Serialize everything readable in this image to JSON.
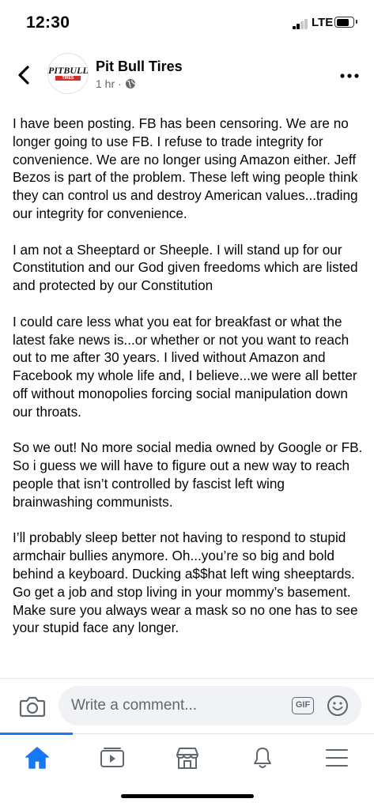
{
  "status_bar": {
    "time": "12:30",
    "network": "LTE",
    "signal_bars_filled": 2,
    "signal_bars_total": 4,
    "battery_level": 0.75
  },
  "header": {
    "page_name": "Pit Bull Tires",
    "time_ago": "1 hr",
    "separator": "·",
    "back_icon": "chevron-left-icon",
    "more_icon": "ellipsis-icon",
    "privacy_icon": "globe-icon",
    "logo_text": "PITBULL",
    "logo_sub": "TIRES"
  },
  "post": {
    "paragraphs": [
      "I have been posting.  FB has been censoring.  We are no longer going to use FB.  I refuse to trade integrity for convenience.  We are no longer using Amazon either. Jeff Bezos is part of the problem.  These left wing people think they can control us and destroy American values...trading our integrity for convenience.",
      "I am not a Sheeptard or Sheeple.  I will stand up for our Constitution and our God given freedoms which are listed and protected by our Constitution",
      "I could care less what you eat for breakfast or what the latest fake news is...or whether or not you want to reach out to me after 30 years.  I lived without Amazon and Facebook my whole life and, I believe...we were all better off without monopolies forcing social manipulation down our throats.",
      "So we out!   No more social media owned by Google or FB.  So i guess we will have to figure out a new way to reach people that isn’t controlled by fascist left wing brainwashing communists.",
      "I’ll probably sleep better not having to respond to stupid armchair bullies anymore.  Oh...you’re so big and bold behind a keyboard. Ducking a$$hat left wing sheeptards.  Go get a job and stop living in your mommy’s basement.  Make sure you always wear a mask so no one has to see your stupid face any longer."
    ]
  },
  "comment_bar": {
    "placeholder": "Write a comment...",
    "gif_label": "GIF",
    "camera_icon": "camera-icon",
    "emoji_icon": "smiley-icon"
  },
  "nav": {
    "items": [
      {
        "name": "home",
        "icon": "home-icon",
        "active": true
      },
      {
        "name": "watch",
        "icon": "video-play-icon",
        "active": false
      },
      {
        "name": "marketplace",
        "icon": "storefront-icon",
        "active": false
      },
      {
        "name": "notifications",
        "icon": "bell-icon",
        "active": false
      },
      {
        "name": "menu",
        "icon": "hamburger-menu-icon",
        "active": false
      }
    ]
  },
  "colors": {
    "accent": "#1877f2",
    "secondary_text": "#65676b",
    "icon_gray": "#606770",
    "input_bg": "#f0f2f5"
  }
}
